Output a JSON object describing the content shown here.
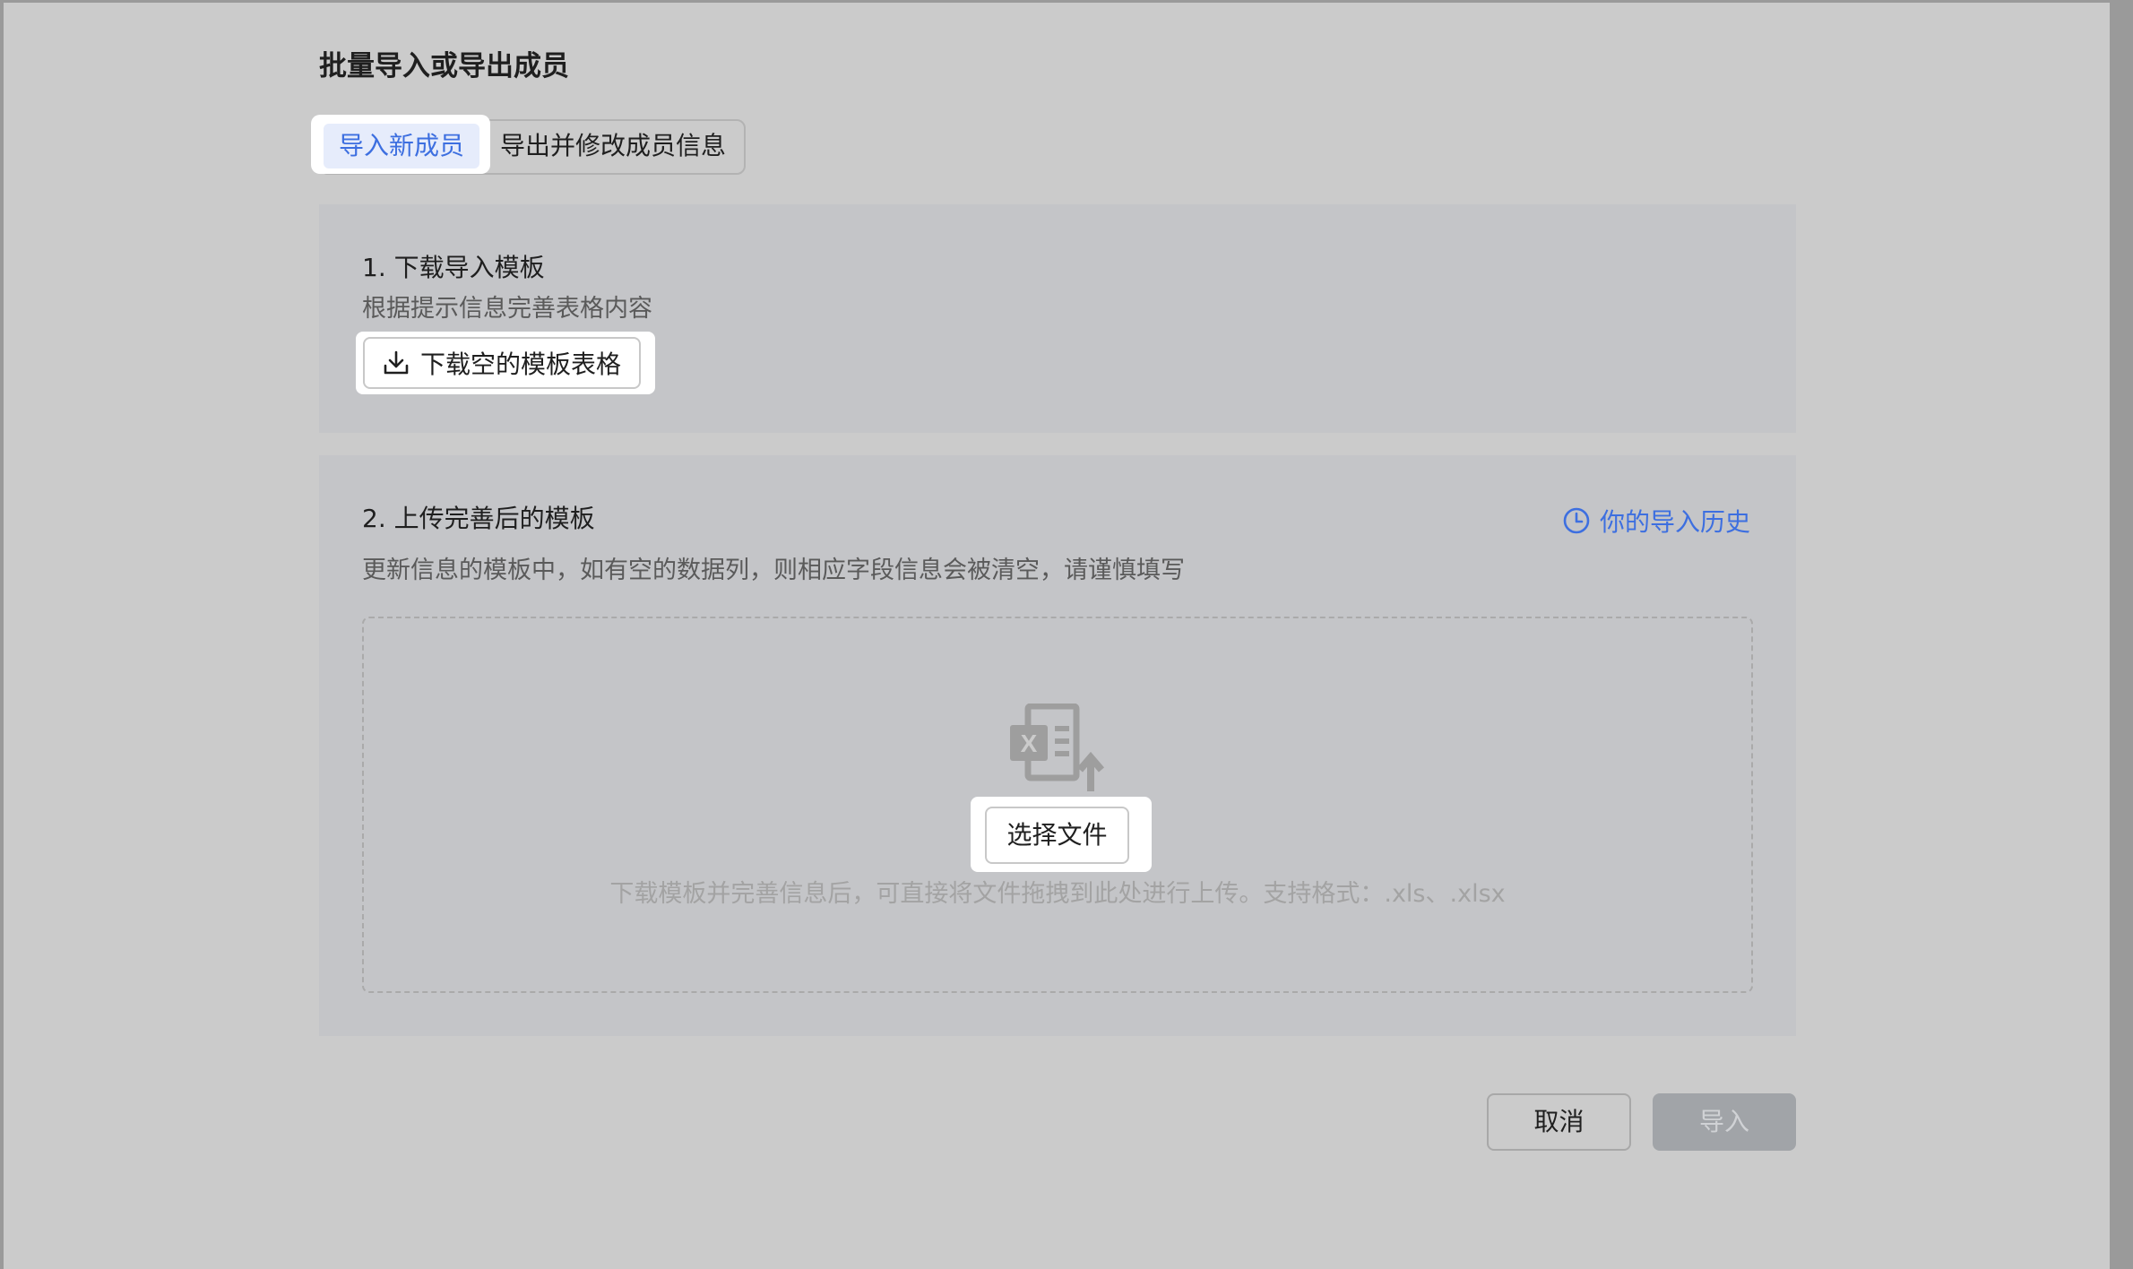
{
  "dialog": {
    "title": "批量导入或导出成员"
  },
  "tabs": {
    "import_new": "导入新成员",
    "export_modify": "导出并修改成员信息",
    "active": "import_new"
  },
  "step1": {
    "title": "1. 下载导入模板",
    "desc": "根据提示信息完善表格内容",
    "download_button": "下载空的模板表格",
    "download_icon": "download-icon"
  },
  "step2": {
    "title": "2. 上传完善后的模板",
    "desc": "更新信息的模板中，如有空的数据列，则相应字段信息会被清空，请谨慎填写",
    "history_link": "你的导入历史",
    "history_icon": "clock-icon",
    "upload_icon": "excel-upload-icon",
    "choose_button": "选择文件",
    "hint": "下载模板并完善信息后，可直接将文件拖拽到此处进行上传。支持格式：.xls、.xlsx"
  },
  "footer": {
    "cancel": "取消",
    "import": "导入"
  },
  "colors": {
    "accent": "#3d6fe0",
    "overlay": "#cbcbcb",
    "card": "#c4c5c8"
  }
}
